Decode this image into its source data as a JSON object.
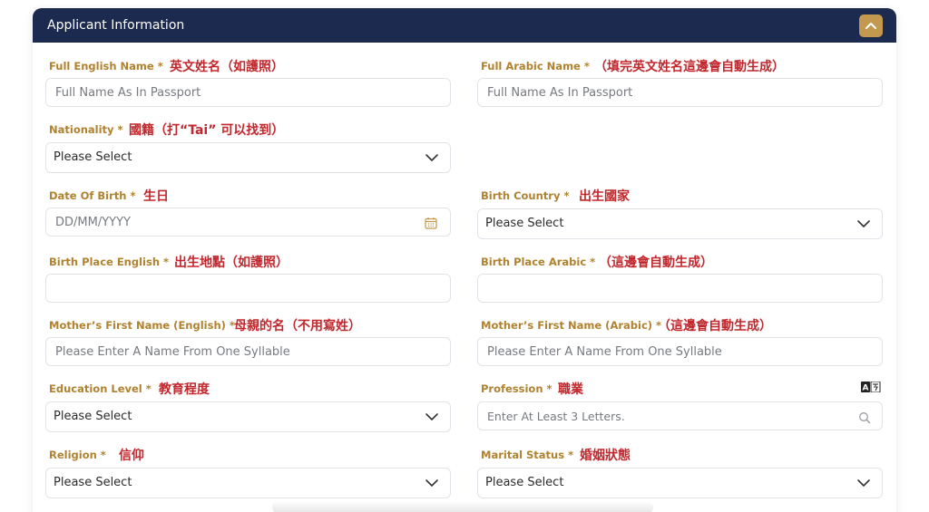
{
  "header": {
    "title": "Applicant Information"
  },
  "fields": {
    "full_english_name": {
      "label": "Full English Name *",
      "note": "英文姓名（如護照）",
      "placeholder": "Full Name As In Passport"
    },
    "full_arabic_name": {
      "label": "Full Arabic Name *",
      "note": "（填完英文姓名這邊會自動生成）",
      "placeholder": "Full Name As In Passport"
    },
    "nationality": {
      "label": "Nationality *",
      "note": "國籍（打“Tai” 可以找到）",
      "value": "Please Select"
    },
    "date_of_birth": {
      "label": "Date Of Birth *",
      "note": "生日",
      "placeholder": "DD/MM/YYYY"
    },
    "birth_country": {
      "label": "Birth Country *",
      "note": "出生國家",
      "value": "Please Select"
    },
    "birth_place_english": {
      "label": "Birth Place English *",
      "note": "出生地點（如護照）",
      "value": ""
    },
    "birth_place_arabic": {
      "label": "Birth Place Arabic *",
      "note": "（這邊會自動生成）",
      "value": ""
    },
    "mother_first_name_english": {
      "label": "Mother’s First Name (English) *",
      "note": "母親的名（不用寫姓）",
      "placeholder": "Please Enter A Name From One Syllable"
    },
    "mother_first_name_arabic": {
      "label": "Mother’s First Name (Arabic) *",
      "note": "（這邊會自動生成）",
      "placeholder": "Please Enter A Name From One Syllable"
    },
    "education_level": {
      "label": "Education Level *",
      "note": "教育程度",
      "value": "Please Select"
    },
    "profession": {
      "label": "Profession *",
      "note": "職業",
      "placeholder": "Enter At Least 3 Letters."
    },
    "religion": {
      "label": "Religion *",
      "note": "信仰",
      "value": "Please Select"
    },
    "marital_status": {
      "label": "Marital Status *",
      "note": "婚姻狀態",
      "value": "Please Select"
    }
  },
  "colors": {
    "header_bg": "#1b2a4e",
    "accent": "#c3994f",
    "label": "#b0822f",
    "note": "#c1272d"
  },
  "icons": [
    "chevron-up-icon",
    "chevron-down-icon",
    "calendar-icon",
    "search-icon",
    "translate-icon"
  ]
}
